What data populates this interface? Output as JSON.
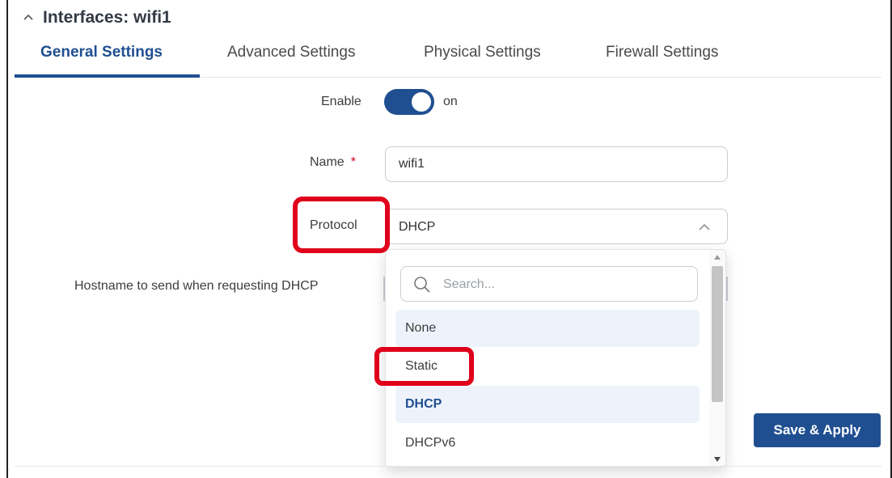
{
  "panel": {
    "title": "Interfaces: wifi1"
  },
  "tabs": [
    {
      "label": "General Settings",
      "active": true
    },
    {
      "label": "Advanced Settings",
      "active": false
    },
    {
      "label": "Physical Settings",
      "active": false
    },
    {
      "label": "Firewall Settings",
      "active": false
    }
  ],
  "form": {
    "enable_label": "Enable",
    "enable_state": "on",
    "name_label": "Name",
    "name_required": "*",
    "name_value": "wifi1",
    "protocol_label": "Protocol",
    "protocol_value": "DHCP",
    "hostname_label": "Hostname to send when requesting DHCP"
  },
  "dropdown": {
    "search_placeholder": "Search...",
    "options": [
      "None",
      "Static",
      "DHCP",
      "DHCPv6"
    ],
    "selected": "DHCP",
    "hovered": "None"
  },
  "actions": {
    "save_label": "Save & Apply"
  },
  "colors": {
    "accent": "#1f4f91",
    "highlight": "#e0001b",
    "option_bg": "#eef3fb"
  }
}
